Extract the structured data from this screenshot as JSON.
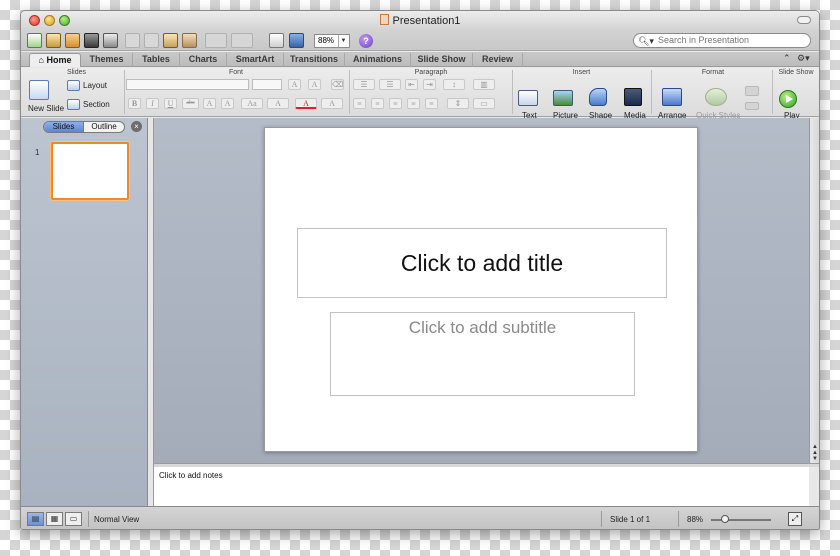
{
  "window": {
    "title": "Presentation1"
  },
  "toolbar": {
    "zoom_value": "88%",
    "search_placeholder": "Search in Presentation",
    "help_glyph": "?"
  },
  "tabs": [
    "Home",
    "Themes",
    "Tables",
    "Charts",
    "SmartArt",
    "Transitions",
    "Animations",
    "Slide Show",
    "Review"
  ],
  "ribbon": {
    "groups": {
      "slides": "Slides",
      "font": "Font",
      "paragraph": "Paragraph",
      "insert": "Insert",
      "format": "Format",
      "slideshow": "Slide Show"
    },
    "buttons": {
      "new_slide": "New Slide",
      "layout": "Layout",
      "section": "Section",
      "text": "Text",
      "picture": "Picture",
      "shape": "Shape",
      "media": "Media",
      "arrange": "Arrange",
      "quick_styles": "Quick Styles",
      "play": "Play"
    },
    "font_glyphs": {
      "bold": "B",
      "italic": "I",
      "underline": "U",
      "strike": "abc",
      "superscript": "A",
      "subscript": "A",
      "font_color": "A"
    }
  },
  "sidebar": {
    "tabs": {
      "slides": "Slides",
      "outline": "Outline"
    },
    "close_glyph": "×",
    "slide_number": "1"
  },
  "slide": {
    "title_placeholder": "Click to add title",
    "subtitle_placeholder": "Click to add subtitle"
  },
  "notes": {
    "placeholder": "Click to add notes"
  },
  "status": {
    "view_name": "Normal View",
    "slide_position": "Slide 1 of 1",
    "zoom": "88%"
  },
  "colors": {
    "accent_orange": "#f08a20",
    "selected_blue": "#6a90d6"
  }
}
